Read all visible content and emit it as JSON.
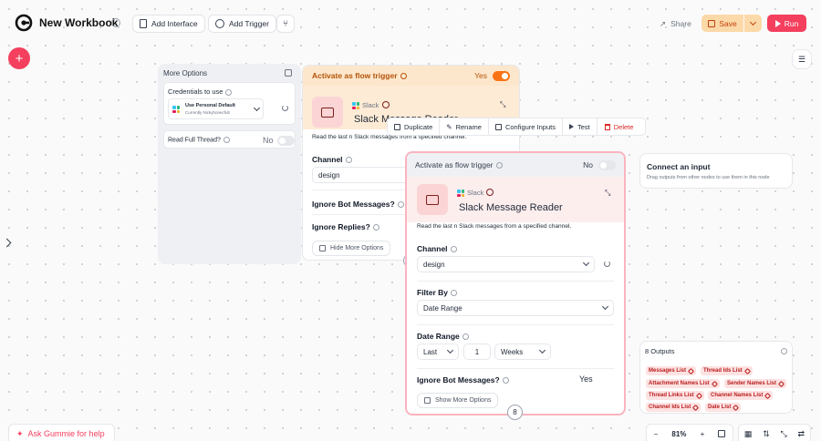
{
  "topbar": {
    "title": "New Workbook",
    "add_interface": "Add Interface",
    "add_trigger": "Add Trigger",
    "share": "Share",
    "save": "Save",
    "run": "Run"
  },
  "more_options_panel": {
    "title": "More Options",
    "credentials_label": "Credentials to use",
    "credential_name": "Use Personal Default",
    "credential_sub": "Currently Nickyhonecfub",
    "read_full_thread_label": "Read Full Thread?",
    "read_full_thread_value": "No"
  },
  "node_back": {
    "trigger_label": "Activate as flow trigger",
    "trigger_value": "Yes",
    "app_name": "Slack",
    "title": "Slack Message Reader",
    "description": "Read the last n Slack messages from a specified channel.",
    "channel_label": "Channel",
    "channel_value": "design",
    "ignore_bot_label": "Ignore Bot Messages?",
    "ignore_replies_label": "Ignore Replies?",
    "hide_more_options": "Hide More Options"
  },
  "context_toolbar": {
    "duplicate": "Duplicate",
    "rename": "Rename",
    "configure_inputs": "Configure Inputs",
    "test": "Test",
    "delete": "Delete"
  },
  "node_front": {
    "trigger_label": "Activate as flow trigger",
    "trigger_value": "No",
    "app_name": "Slack",
    "title": "Slack Message Reader",
    "description": "Read the last n Slack messages from a specified channel.",
    "channel_label": "Channel",
    "channel_value": "design",
    "filter_by_label": "Filter By",
    "filter_by_value": "Date Range",
    "date_range_label": "Date Range",
    "date_range_mode": "Last",
    "date_range_amount": "1",
    "date_range_unit": "Weeks",
    "ignore_bot_label": "Ignore Bot Messages?",
    "ignore_bot_value": "Yes",
    "show_more_options": "Show More Options",
    "badge_count": "8"
  },
  "connect_input": {
    "title": "Connect an input",
    "subtitle": "Drag outputs from other nodes to use them in this node"
  },
  "outputs": {
    "title": "8 Outputs",
    "items": [
      "Messages List",
      "Thread Ids List",
      "Attachment Names List",
      "Sender Names List",
      "Thread Links List",
      "Channel Names List",
      "Channel Ids List",
      "Date List"
    ]
  },
  "bottom": {
    "help": "Ask Gummie for help",
    "zoom": "81%"
  },
  "colors": {
    "accent": "#f43f5e",
    "trigger_bg": "#fde7cc",
    "save_bg": "#fcd9a8",
    "tag_bg": "#fde2e2"
  }
}
